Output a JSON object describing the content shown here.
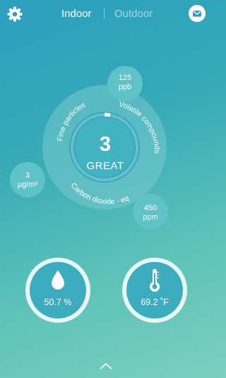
{
  "header": {
    "tab_indoor": "Indoor",
    "tab_outdoor": "Outdoor"
  },
  "dial": {
    "score": "3",
    "rating": "GREAT",
    "segments": {
      "fine_particles": {
        "label": "Fine particles",
        "value": "3",
        "unit": "µg/m³"
      },
      "volatile_compounds": {
        "label": "Volatile compounds",
        "value": "125",
        "unit": "ppb"
      },
      "carbon_dioxide": {
        "label": "Carbon dioxide - eq",
        "value": "450",
        "unit": "ppm"
      }
    }
  },
  "gauges": {
    "humidity": {
      "label": "50.7 %",
      "level": 0.507,
      "icon": "water-drop-icon"
    },
    "temperature": {
      "label": "69.2 ˚F",
      "level": 0.5,
      "icon": "thermometer-icon"
    }
  },
  "colors": {
    "background_top": "#2b9fbe",
    "background_bottom": "#7ccfbf",
    "panel": "#5dc0c4",
    "core": "#3fb0c0"
  },
  "icons": [
    "gear-icon",
    "mail-icon",
    "water-drop-icon",
    "thermometer-icon",
    "chevron-up-icon"
  ]
}
